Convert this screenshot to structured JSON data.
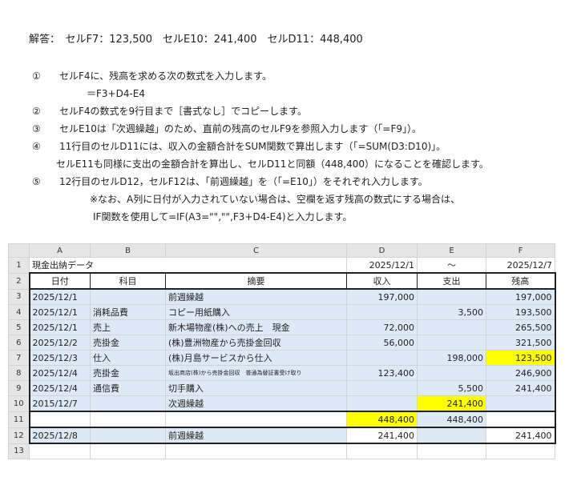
{
  "answer": "解答：　セルF7：123,500　セルE10：241,400　セルD11：448,400",
  "steps": [
    {
      "num": "①",
      "text": "セルF4に、残高を求める次の数式を入力します。"
    },
    {
      "num": "",
      "text": "＝F3+D4-E4",
      "indent": "1"
    },
    {
      "num": "②",
      "text": "セルF4の数式を9行目まで［書式なし］でコピーします。"
    },
    {
      "num": "③",
      "text": "セルE10は「次週繰越」のため、直前の残高のセルF9を参照入力します（「=F9」）。"
    },
    {
      "num": "④",
      "text": "11行目のセルD11には、収入の金額合計をSUM関数で算出します（「=SUM(D3:D10)」。"
    },
    {
      "num": "",
      "text": "セルE11も同様に支出の金額合計を算出し、セルD11と同額（448,400）になることを確認します。",
      "indent": "0"
    },
    {
      "num": "⑤",
      "text": "12行目のセルD12，セルF12は、「前週繰越」を（「=E10」）をそれぞれ入力します。"
    },
    {
      "num": "",
      "text": "※なお、A列に日付が入力されていない場合は、空欄を返す残高の数式にする場合は、",
      "indent": "2"
    },
    {
      "num": "",
      "text": "IF関数を使用して=IF(A3=\"\",\"\",F3+D4-E4)と入力します。",
      "indent": "2"
    }
  ],
  "sheet": {
    "col_headers": [
      "A",
      "B",
      "C",
      "D",
      "E",
      "F"
    ],
    "row1": {
      "a": "現金出納データ",
      "d": "2025/12/1",
      "e": "～",
      "f": "2025/12/7"
    },
    "row2": {
      "a": "日付",
      "b": "科目",
      "c": "摘要",
      "d": "収入",
      "e": "支出",
      "f": "残高"
    },
    "rows": [
      {
        "a": "2025/12/1",
        "b": "",
        "c": "前週繰越",
        "d": "197,000",
        "e": "",
        "f": "197,000"
      },
      {
        "a": "2025/12/1",
        "b": "消耗品費",
        "c": "コピー用紙購入",
        "d": "",
        "e": "3,500",
        "f": "193,500"
      },
      {
        "a": "2025/12/1",
        "b": "売上",
        "c": "新木場物産(株)への売上　現金",
        "d": "72,000",
        "e": "",
        "f": "265,500"
      },
      {
        "a": "2025/12/2",
        "b": "売掛金",
        "c": "(株)豊洲物産から売掛金回収",
        "d": "56,000",
        "e": "",
        "f": "321,500"
      },
      {
        "a": "2025/12/3",
        "b": "仕入",
        "c": "(株)月島サービスから仕入",
        "d": "",
        "e": "198,000",
        "f": "123,500"
      },
      {
        "a": "2025/12/4",
        "b": "売掛金",
        "c": "坂出商店(株)から売掛金回収　普通為替証書受け取り",
        "d": "123,400",
        "e": "",
        "f": "246,900"
      },
      {
        "a": "2025/12/4",
        "b": "通信費",
        "c": "切手購入",
        "d": "",
        "e": "5,500",
        "f": "241,400"
      },
      {
        "a": "2015/12/7",
        "b": "",
        "c": "次週繰越",
        "d": "",
        "e": "241,400",
        "f": ""
      }
    ],
    "row11": {
      "d": "448,400",
      "e": "448,400"
    },
    "row12": {
      "a": "2025/12/8",
      "c": "前週繰越",
      "d": "241,400",
      "f": "241,400"
    },
    "row_numbers": [
      "1",
      "2",
      "3",
      "4",
      "5",
      "6",
      "7",
      "8",
      "9",
      "10",
      "11",
      "12",
      "13"
    ]
  }
}
